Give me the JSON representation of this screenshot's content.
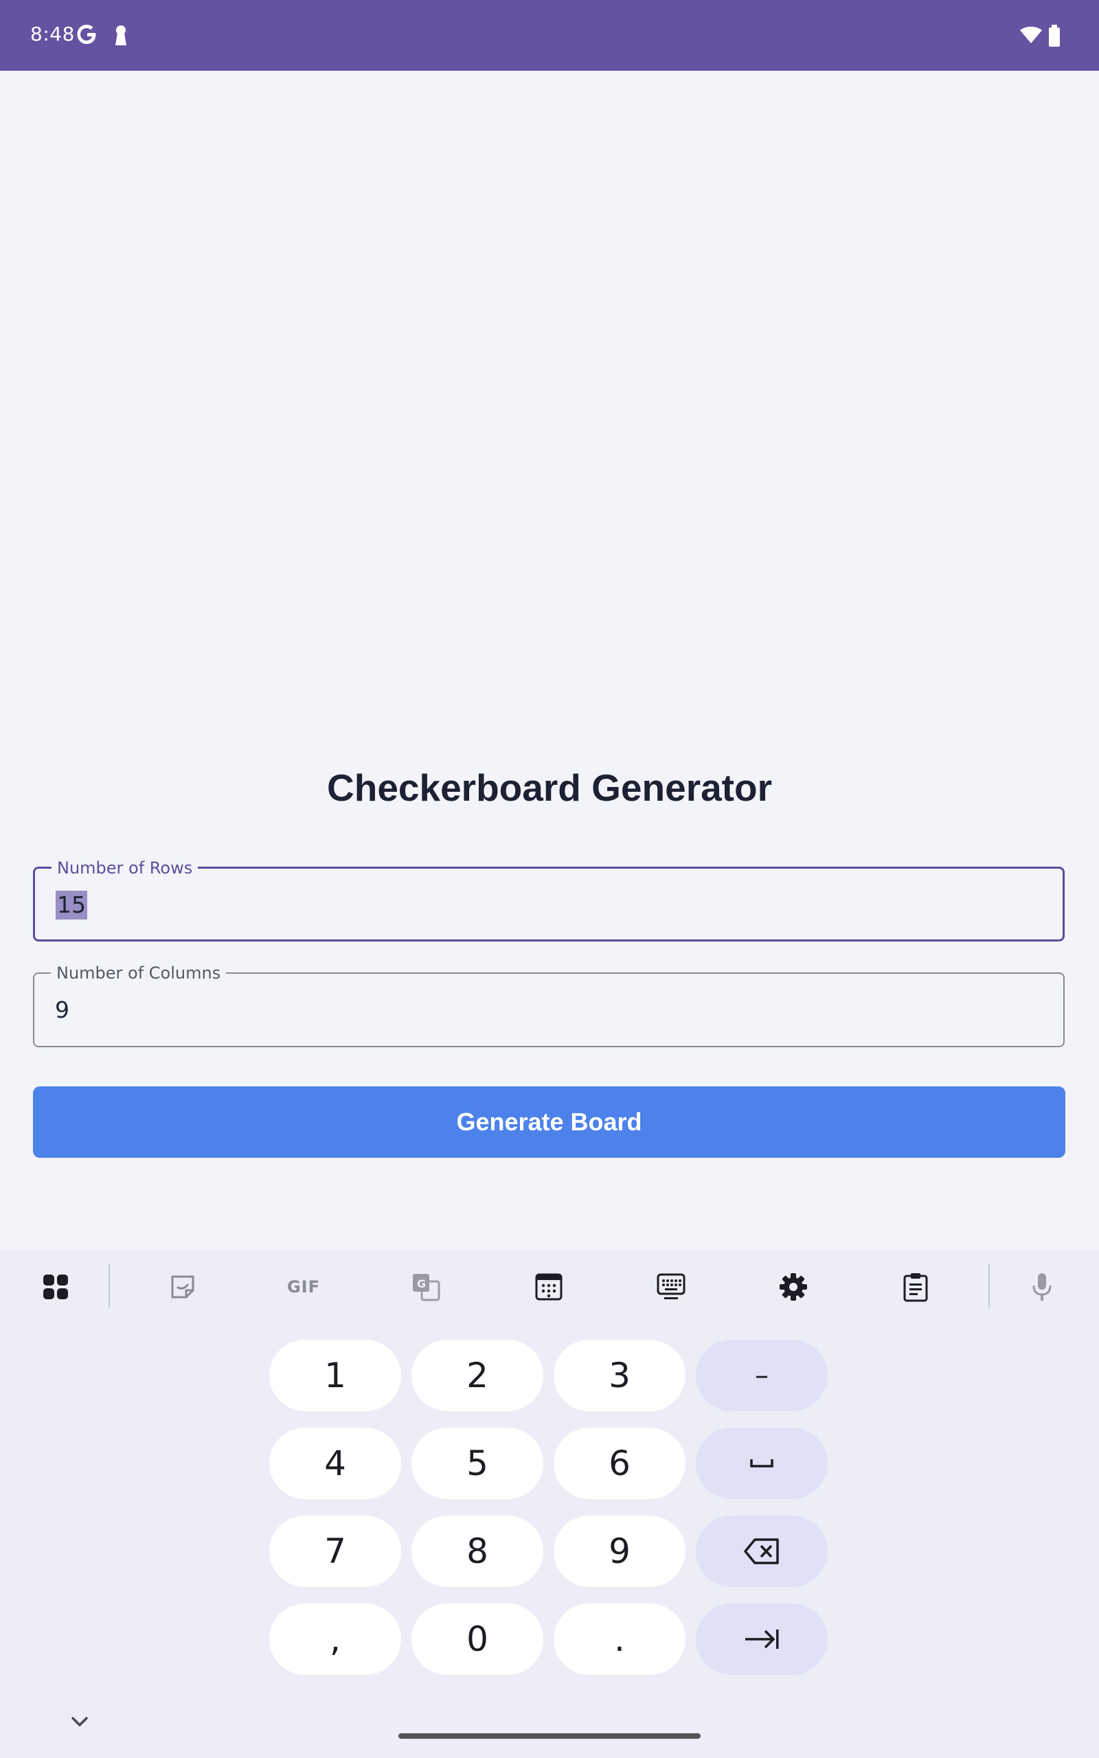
{
  "status_bar": {
    "time": "8:48",
    "bg_color": "#6552a1",
    "icons": [
      "google-g-icon",
      "keyhole-icon",
      "wifi-icon",
      "battery-icon"
    ]
  },
  "app": {
    "title": "Checkerboard Generator",
    "rows_field": {
      "label": "Number of Rows",
      "value": "15",
      "focused": true,
      "text_selected": true
    },
    "cols_field": {
      "label": "Number of Columns",
      "value": "9"
    },
    "generate_button": {
      "label": "Generate Board",
      "color": "#4d82ea"
    },
    "accent_color": "#5e4d9c"
  },
  "keyboard": {
    "toolbar": [
      "apps-grid-icon",
      "sticker-icon",
      "gif-icon",
      "translate-icon",
      "number-pad-icon",
      "keyboard-icon",
      "settings-gear-icon",
      "clipboard-icon",
      "microphone-icon"
    ],
    "gif_label": "GIF",
    "keys": {
      "k1": "1",
      "k2": "2",
      "k3": "3",
      "dash": "–",
      "k4": "4",
      "k5": "5",
      "k6": "6",
      "k7": "7",
      "k8": "8",
      "k9": "9",
      "comma": ",",
      "k0": "0",
      "period": "."
    },
    "special_keys": [
      "space-icon",
      "backspace-icon",
      "tab-next-icon"
    ]
  }
}
